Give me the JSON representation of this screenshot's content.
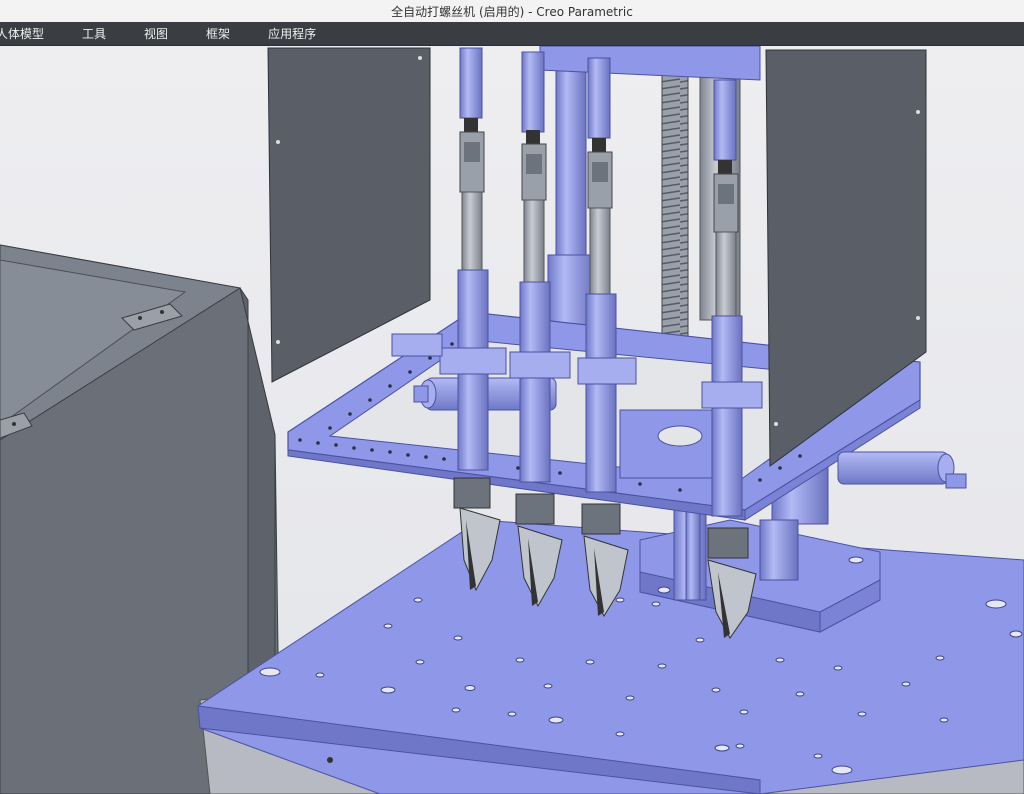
{
  "window": {
    "title": "全自动打螺丝机 (启用的) - Creo Parametric"
  },
  "menubar": {
    "items": [
      {
        "label": "人体模型"
      },
      {
        "label": "工具"
      },
      {
        "label": "视图"
      },
      {
        "label": "框架"
      },
      {
        "label": "应用程序"
      }
    ]
  },
  "viewport": {
    "model_color": "#8e97e8",
    "panel_color": "#5a5e66",
    "background_color": "#e6e7eb"
  }
}
